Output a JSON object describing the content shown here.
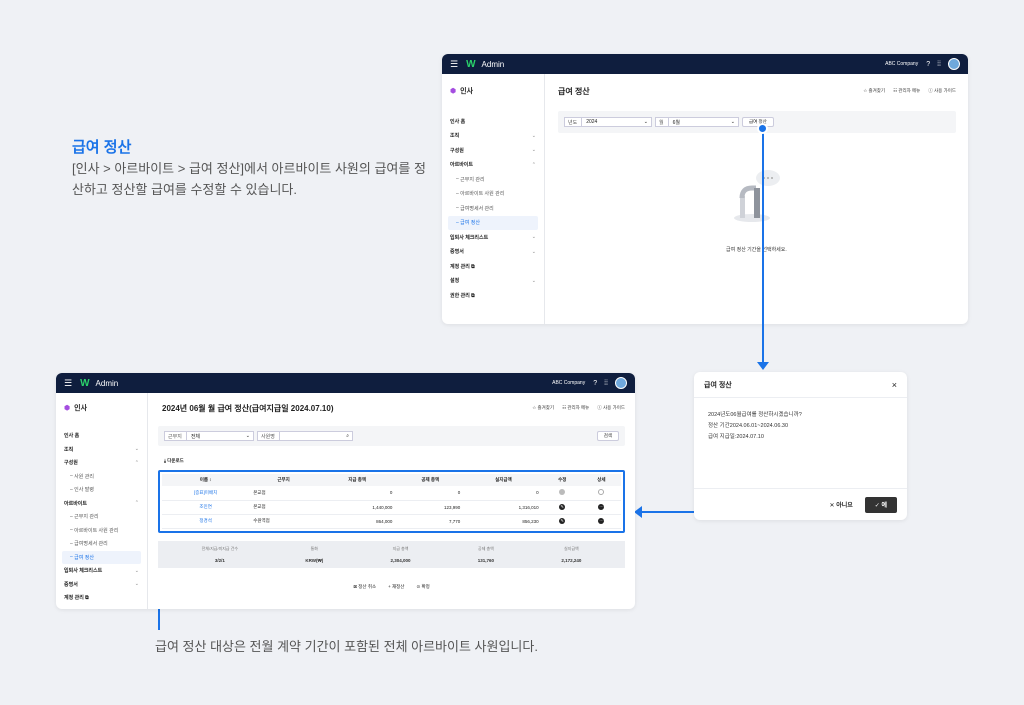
{
  "intro": {
    "title": "급여 정산",
    "desc": "[인사 > 아르바이트 > 급여 정산]에서 아르바이트 사원의 급여를 정산하고 정산할 급여를 수정할 수 있습니다."
  },
  "caption": "급여 정산 대상은 전월 계약 기간이 포함된 전체 아르바이트 사원입니다.",
  "topbar": {
    "app": "Admin",
    "company": "ABC Company"
  },
  "win1": {
    "section": "인사",
    "page_title": "급여 정산",
    "links": [
      "☆ 즐겨찾기",
      "☷ 관리자 메뉴",
      "ⓘ 사용 가이드"
    ],
    "menu": [
      {
        "label": "인사 홈",
        "chev": ""
      },
      {
        "label": "조직",
        "chev": "⌄"
      },
      {
        "label": "구성원",
        "chev": "⌄"
      },
      {
        "label": "아르바이트",
        "chev": "⌃"
      }
    ],
    "sub": [
      "근무지 관리",
      "아르바이트 사원 관리",
      "급여명세서 관리",
      "급여 정산"
    ],
    "menu2": [
      {
        "label": "입퇴사 체크리스트",
        "chev": "⌄"
      },
      {
        "label": "증명서",
        "chev": "⌄"
      },
      {
        "label": "계정 관리 ⧉",
        "chev": ""
      },
      {
        "label": "설정",
        "chev": "⌄"
      },
      {
        "label": "권한 관리 ⧉",
        "chev": ""
      }
    ],
    "filter": {
      "year_label": "년도",
      "year_value": "2024",
      "month_label": "월",
      "month_value": "6월",
      "button": "급여 정산"
    },
    "empty_message": "급여 정산 기간을 선택하세요."
  },
  "win2": {
    "section": "인사",
    "page_title": "2024년 06월 월 급여 정산(급여지급일 2024.07.10)",
    "links": [
      "☆ 즐겨찾기",
      "☷ 관리자 메뉴",
      "ⓘ 사용 가이드"
    ],
    "menu": [
      {
        "label": "인사 홈",
        "chev": ""
      },
      {
        "label": "조직",
        "chev": "⌄"
      },
      {
        "label": "구성원",
        "chev": "⌃"
      }
    ],
    "sub1": [
      "사원 관리",
      "인사 발령"
    ],
    "menu_alba": {
      "label": "아르바이트",
      "chev": "⌃"
    },
    "sub2": [
      "근무지 관리",
      "아르바이트 사원 관리",
      "급여명세서 관리",
      "급여 정산"
    ],
    "menu2": [
      {
        "label": "입퇴사 체크리스트",
        "chev": "⌄"
      },
      {
        "label": "증명서",
        "chev": "⌄"
      },
      {
        "label": "계정 관리 ⧉",
        "chev": ""
      }
    ],
    "filter": {
      "place_label": "근무지",
      "place_value": "전체",
      "name_placeholder": "사원명",
      "search_button": "검색"
    },
    "download": "⤓ 다운로드",
    "table": {
      "headers": [
        "이름 ↕",
        "근무지",
        "지급 총액",
        "공제 총액",
        "실지급액",
        "수정",
        "상세"
      ],
      "rows": [
        [
          "[증표]미배치",
          "본교점",
          "0",
          "0",
          "0",
          "gray",
          "light"
        ],
        [
          "조민연",
          "본교점",
          "1,440,000",
          "123,990",
          "1,316,010",
          "dark",
          "dark"
        ],
        [
          "정경석",
          "수원역점",
          "864,000",
          "7,770",
          "856,230",
          "dark",
          "dark"
        ]
      ]
    },
    "summary": [
      {
        "label": "전체/지급/미지급 건수",
        "value": "3/2/1"
      },
      {
        "label": "통화",
        "value": "KRW(₩)"
      },
      {
        "label": "지급 총액",
        "value": "2,304,000"
      },
      {
        "label": "공제 총액",
        "value": "131,760"
      },
      {
        "label": "실지급액",
        "value": "2,172,240"
      }
    ],
    "actions": [
      "⊠ 정산 취소",
      "+ 재정산",
      "⊙ 확정"
    ]
  },
  "dialog": {
    "title": "급여 정산",
    "close": "×",
    "lines": [
      "2024년도06월급여를 정산하시겠습니까?",
      "정산 기간2024.06.01~2024.06.30",
      "급여 지급일:2024.07.10"
    ],
    "no": "✕ 아니요",
    "yes": "✓ 예"
  }
}
